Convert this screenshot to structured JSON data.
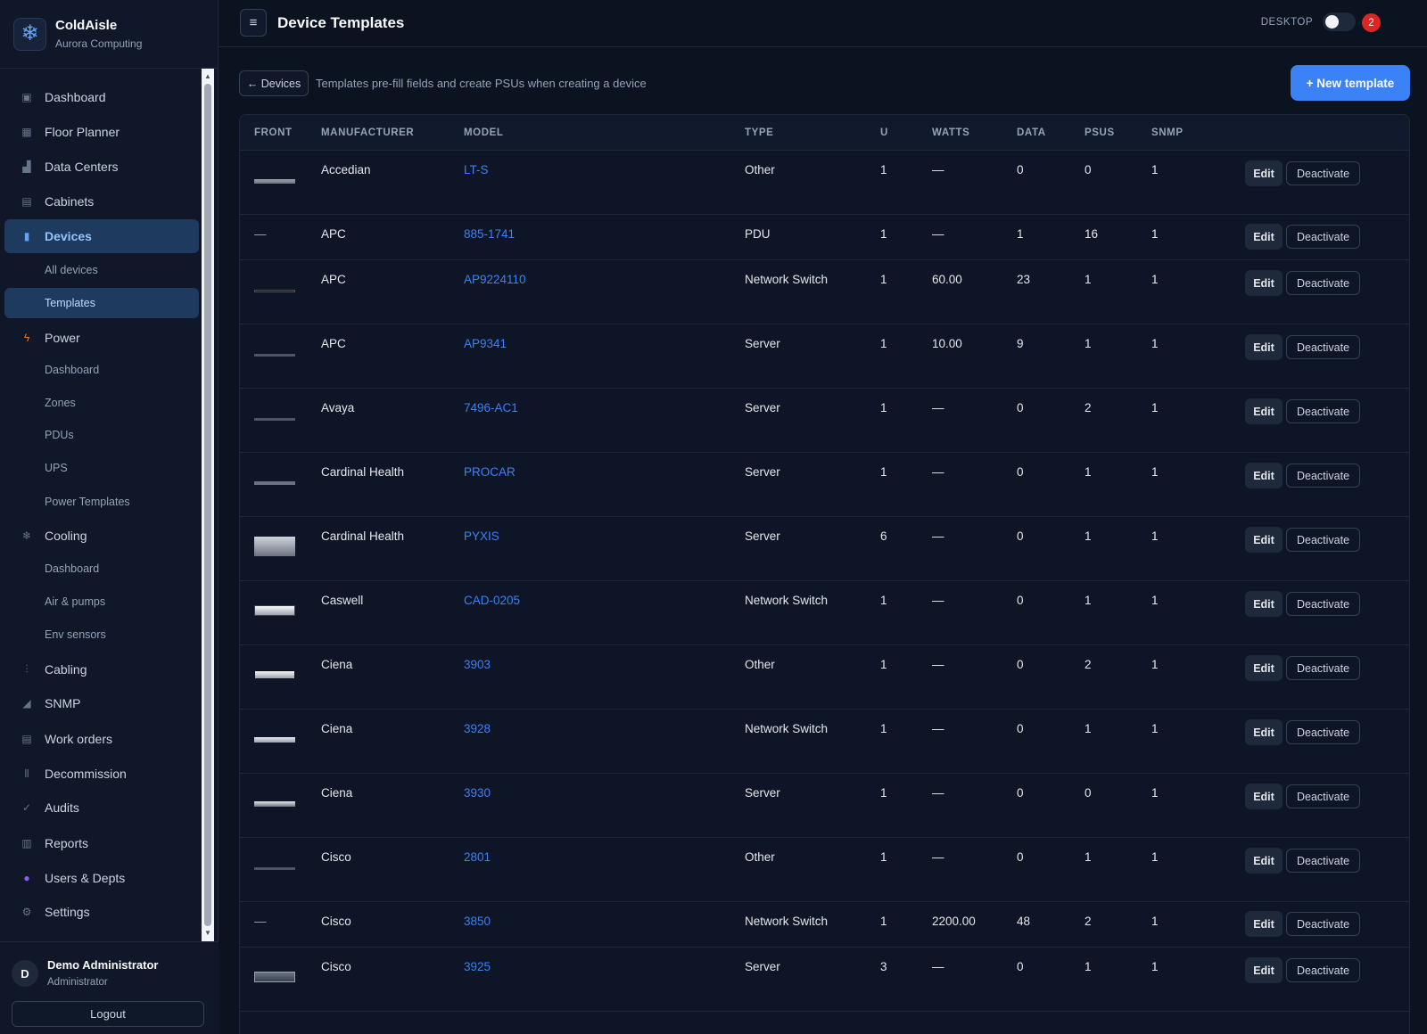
{
  "brand": {
    "name": "ColdAisle",
    "org": "Aurora Computing",
    "logo_icon": "snowflake-icon"
  },
  "header": {
    "title": "Device Templates",
    "desktop_label": "DESKTOP",
    "notification_count": "2",
    "menu_icon": "≡"
  },
  "toolbar": {
    "back_label": "← Devices",
    "note": "Templates pre-fill fields and create PSUs when creating a device",
    "new_label": "+ New template"
  },
  "sidebar": {
    "items": [
      {
        "label": "Dashboard",
        "icon": "▣",
        "icon_name": "dashboard-icon"
      },
      {
        "label": "Floor Planner",
        "icon": "▦",
        "icon_name": "floor-planner-icon"
      },
      {
        "label": "Data Centers",
        "icon": "▟",
        "icon_name": "data-centers-icon"
      },
      {
        "label": "Cabinets",
        "icon": "▤",
        "icon_name": "cabinet-icon"
      },
      {
        "label": "Devices",
        "icon": "▮",
        "icon_name": "device-icon"
      },
      {
        "label": "All devices"
      },
      {
        "label": "Templates"
      },
      {
        "label": "Power",
        "icon": "ϟ",
        "icon_name": "power-icon"
      },
      {
        "label": "Dashboard"
      },
      {
        "label": "Zones"
      },
      {
        "label": "PDUs"
      },
      {
        "label": "UPS"
      },
      {
        "label": "Power Templates"
      },
      {
        "label": "Cooling",
        "icon": "❄",
        "icon_name": "cooling-icon"
      },
      {
        "label": "Dashboard"
      },
      {
        "label": "Air & pumps"
      },
      {
        "label": "Env sensors"
      },
      {
        "label": "Cabling",
        "icon": "⫶",
        "icon_name": "cabling-icon"
      },
      {
        "label": "SNMP",
        "icon": "◢",
        "icon_name": "snmp-icon"
      },
      {
        "label": "Work orders",
        "icon": "▤",
        "icon_name": "work-orders-icon"
      },
      {
        "label": "Decommission",
        "icon": "⦀",
        "icon_name": "decommission-icon"
      },
      {
        "label": "Audits",
        "icon": "✓",
        "icon_name": "audit-icon"
      },
      {
        "label": "Reports",
        "icon": "▥",
        "icon_name": "reports-icon"
      },
      {
        "label": "Users & Depts",
        "icon": "●",
        "icon_name": "users-icon"
      },
      {
        "label": "Settings",
        "icon": "⚙",
        "icon_name": "settings-icon"
      }
    ]
  },
  "user": {
    "initial": "D",
    "name": "Demo Administrator",
    "role": "Administrator",
    "logout_label": "Logout"
  },
  "table": {
    "headers": [
      "FRONT",
      "MANUFACTURER",
      "MODEL",
      "TYPE",
      "U",
      "WATTS",
      "DATA",
      "PSUS",
      "SNMP"
    ],
    "edit_label": "Edit",
    "deactivate_label": "Deactivate",
    "rows": [
      {
        "front": "img",
        "manufacturer": "Accedian",
        "model": "LT-S",
        "type": "Other",
        "u": "1",
        "watts": "—",
        "data": "0",
        "psus": "0",
        "snmp": "1"
      },
      {
        "front": "—",
        "manufacturer": "APC",
        "model": "885-1741",
        "type": "PDU",
        "u": "1",
        "watts": "—",
        "data": "1",
        "psus": "16",
        "snmp": "1"
      },
      {
        "front": "img",
        "manufacturer": "APC",
        "model": "AP9224110",
        "type": "Network Switch",
        "u": "1",
        "watts": "60.00",
        "data": "23",
        "psus": "1",
        "snmp": "1"
      },
      {
        "front": "img",
        "manufacturer": "APC",
        "model": "AP9341",
        "type": "Server",
        "u": "1",
        "watts": "10.00",
        "data": "9",
        "psus": "1",
        "snmp": "1"
      },
      {
        "front": "img",
        "manufacturer": "Avaya",
        "model": "7496-AC1",
        "type": "Server",
        "u": "1",
        "watts": "—",
        "data": "0",
        "psus": "2",
        "snmp": "1"
      },
      {
        "front": "img",
        "manufacturer": "Cardinal Health",
        "model": "PROCAR",
        "type": "Server",
        "u": "1",
        "watts": "—",
        "data": "0",
        "psus": "1",
        "snmp": "1"
      },
      {
        "front": "img",
        "manufacturer": "Cardinal Health",
        "model": "PYXIS",
        "type": "Server",
        "u": "6",
        "watts": "—",
        "data": "0",
        "psus": "1",
        "snmp": "1"
      },
      {
        "front": "img",
        "manufacturer": "Caswell",
        "model": "CAD-0205",
        "type": "Network Switch",
        "u": "1",
        "watts": "—",
        "data": "0",
        "psus": "1",
        "snmp": "1"
      },
      {
        "front": "img",
        "manufacturer": "Ciena",
        "model": "3903",
        "type": "Other",
        "u": "1",
        "watts": "—",
        "data": "0",
        "psus": "2",
        "snmp": "1"
      },
      {
        "front": "img",
        "manufacturer": "Ciena",
        "model": "3928",
        "type": "Network Switch",
        "u": "1",
        "watts": "—",
        "data": "0",
        "psus": "1",
        "snmp": "1"
      },
      {
        "front": "img",
        "manufacturer": "Ciena",
        "model": "3930",
        "type": "Server",
        "u": "1",
        "watts": "—",
        "data": "0",
        "psus": "0",
        "snmp": "1"
      },
      {
        "front": "img",
        "manufacturer": "Cisco",
        "model": "2801",
        "type": "Other",
        "u": "1",
        "watts": "—",
        "data": "0",
        "psus": "1",
        "snmp": "1"
      },
      {
        "front": "—",
        "manufacturer": "Cisco",
        "model": "3850",
        "type": "Network Switch",
        "u": "1",
        "watts": "2200.00",
        "data": "48",
        "psus": "2",
        "snmp": "1"
      },
      {
        "front": "img",
        "manufacturer": "Cisco",
        "model": "3925",
        "type": "Server",
        "u": "3",
        "watts": "—",
        "data": "0",
        "psus": "1",
        "snmp": "1"
      }
    ]
  },
  "colors": {
    "accent": "#3b82f6",
    "background": "#0b1220",
    "sidebar": "#0f1729",
    "active": "#1e3a5f",
    "danger": "#dc2626"
  }
}
